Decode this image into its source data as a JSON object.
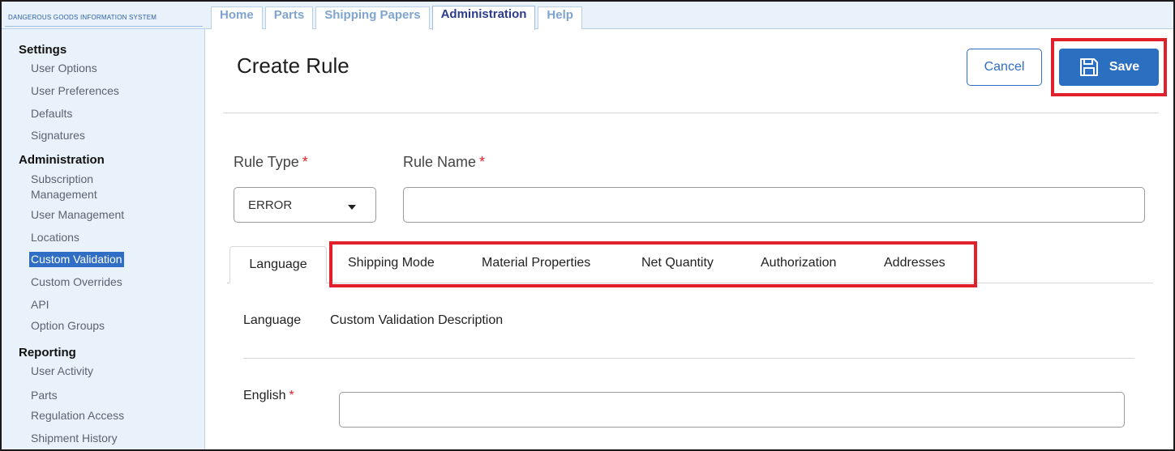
{
  "app": {
    "brand": "Dangerous Goods Information System"
  },
  "nav": {
    "tabs": [
      "Home",
      "Parts",
      "Shipping Papers",
      "Administration",
      "Help"
    ],
    "active": "Administration"
  },
  "sidebar": {
    "sections": [
      {
        "heading": "Settings",
        "items": [
          "User Options",
          "User Preferences",
          "Defaults",
          "Signatures"
        ]
      },
      {
        "heading": "Administration",
        "items": [
          "Subscription",
          "Management",
          "User Management",
          "Locations",
          "Custom Validation",
          "Custom Overrides",
          "API",
          "Option Groups"
        ]
      },
      {
        "heading": "Reporting",
        "items": [
          "User Activity",
          "Parts",
          "Regulation Access",
          "Shipment History"
        ]
      }
    ],
    "active_item": "Custom Validation"
  },
  "page": {
    "title": "Create Rule",
    "cancel_label": "Cancel",
    "save_label": "Save"
  },
  "form": {
    "rule_type_label": "Rule Type",
    "rule_name_label": "Rule Name",
    "required_mark": "*",
    "rule_type_value": "ERROR",
    "rule_name_value": ""
  },
  "tabs": [
    "Language",
    "Shipping Mode",
    "Material Properties",
    "Net Quantity",
    "Authorization",
    "Addresses"
  ],
  "language_table": {
    "col_language": "Language",
    "col_description": "Custom Validation Description",
    "row_english": "English",
    "english_value": ""
  },
  "colors": {
    "accent": "#2b6fc0",
    "highlight": "#e0202b",
    "sidebar_bg": "#e9f2fb"
  }
}
